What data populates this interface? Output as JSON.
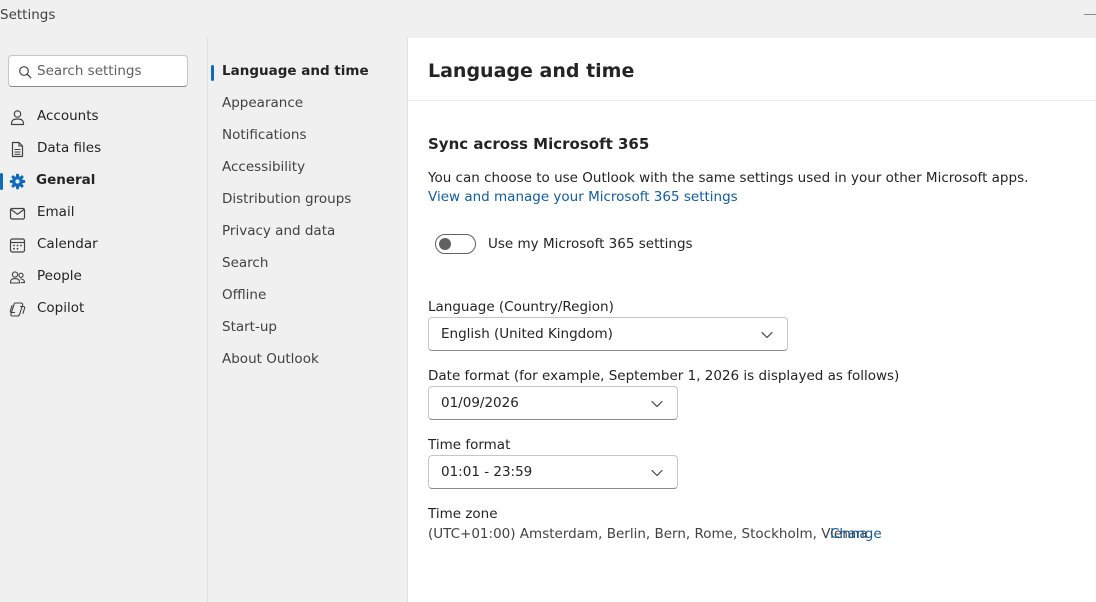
{
  "window": {
    "title": "Settings"
  },
  "search": {
    "placeholder": "Search settings"
  },
  "left_nav": {
    "items": [
      {
        "label": "Accounts",
        "icon": "person-icon"
      },
      {
        "label": "Data files",
        "icon": "document-icon"
      },
      {
        "label": "General",
        "icon": "gear-icon",
        "active": true
      },
      {
        "label": "Email",
        "icon": "mail-icon"
      },
      {
        "label": "Calendar",
        "icon": "calendar-icon"
      },
      {
        "label": "People",
        "icon": "people-icon"
      },
      {
        "label": "Copilot",
        "icon": "copilot-icon"
      }
    ]
  },
  "sub_nav": {
    "items": [
      {
        "label": "Language and time",
        "active": true
      },
      {
        "label": "Appearance"
      },
      {
        "label": "Notifications"
      },
      {
        "label": "Accessibility"
      },
      {
        "label": "Distribution groups"
      },
      {
        "label": "Privacy and data"
      },
      {
        "label": "Search"
      },
      {
        "label": "Offline"
      },
      {
        "label": "Start-up"
      },
      {
        "label": "About Outlook"
      }
    ]
  },
  "main": {
    "title": "Language and time",
    "sync": {
      "title": "Sync across Microsoft 365",
      "description": "You can choose to use Outlook with the same settings used in your other Microsoft apps.",
      "link": "View and manage your Microsoft 365 settings",
      "toggle_label": "Use my Microsoft 365 settings",
      "toggle_on": false
    },
    "language": {
      "label": "Language (Country/Region)",
      "value": "English (United Kingdom)"
    },
    "date_format": {
      "label": "Date format (for example, September 1, 2026 is displayed as follows)",
      "value": "01/09/2026"
    },
    "time_format": {
      "label": "Time format",
      "value": "01:01 - 23:59"
    },
    "time_zone": {
      "label": "Time zone",
      "value": "(UTC+01:00) Amsterdam, Berlin, Bern, Rome, Stockholm, Vienna",
      "change_label": "Change"
    }
  },
  "colors": {
    "accent": "#0f6cbd",
    "link": "#115ea3",
    "pane_bg": "#f0f0f0",
    "content_bg": "#ffffff"
  }
}
